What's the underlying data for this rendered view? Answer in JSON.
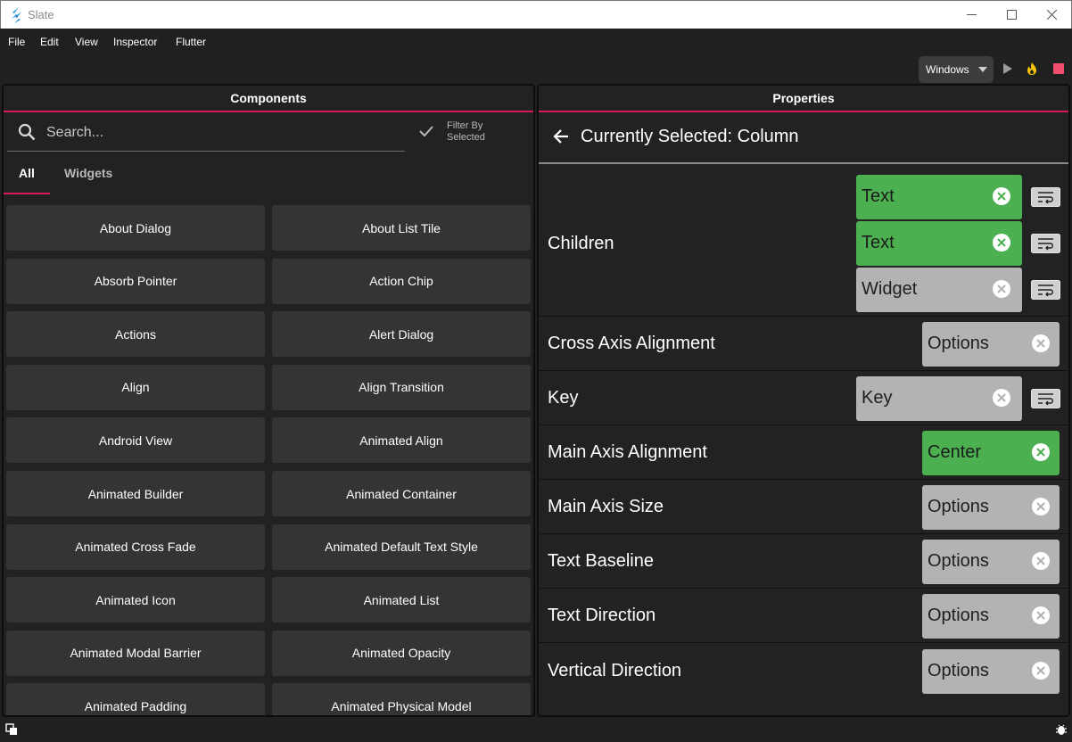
{
  "window": {
    "title": "Slate"
  },
  "menu": [
    "File",
    "Edit",
    "View",
    "Inspector",
    "Flutter"
  ],
  "toolbar": {
    "platform": "Windows"
  },
  "components": {
    "header": "Components",
    "search_placeholder": "Search...",
    "filter_label": "Filter By Selected",
    "tabs": [
      "All",
      "Widgets"
    ],
    "items": [
      "About Dialog",
      "About List Tile",
      "Absorb Pointer",
      "Action Chip",
      "Actions",
      "Alert Dialog",
      "Align",
      "Align Transition",
      "Android View",
      "Animated Align",
      "Animated Builder",
      "Animated Container",
      "Animated Cross Fade",
      "Animated Default Text Style",
      "Animated Icon",
      "Animated List",
      "Animated Modal Barrier",
      "Animated Opacity",
      "Animated Padding",
      "Animated Physical Model"
    ]
  },
  "properties": {
    "header": "Properties",
    "selected": "Currently Selected: Column",
    "rows": [
      {
        "label": "Children",
        "chips": [
          {
            "value": "Text",
            "color": "green",
            "wrap": true
          },
          {
            "value": "Text",
            "color": "green",
            "wrap": true
          },
          {
            "value": "Widget",
            "color": "grey",
            "wrap": true
          }
        ]
      },
      {
        "label": "Cross Axis Alignment",
        "chips": [
          {
            "value": "Options",
            "color": "grey",
            "wrap": false
          }
        ]
      },
      {
        "label": "Key",
        "chips": [
          {
            "value": "Key",
            "color": "grey",
            "wrap": true
          }
        ]
      },
      {
        "label": "Main Axis Alignment",
        "chips": [
          {
            "value": "Center",
            "color": "green",
            "wrap": false
          }
        ]
      },
      {
        "label": "Main Axis Size",
        "chips": [
          {
            "value": "Options",
            "color": "grey",
            "wrap": false
          }
        ]
      },
      {
        "label": "Text Baseline",
        "chips": [
          {
            "value": "Options",
            "color": "grey",
            "wrap": false
          }
        ]
      },
      {
        "label": "Text Direction",
        "chips": [
          {
            "value": "Options",
            "color": "grey",
            "wrap": false
          }
        ]
      },
      {
        "label": "Vertical Direction",
        "chips": [
          {
            "value": "Options",
            "color": "grey",
            "wrap": false
          }
        ]
      }
    ]
  },
  "colors": {
    "accent": "#d81b60",
    "chip_green": "#4caf50",
    "chip_grey": "#b3b3b3"
  }
}
